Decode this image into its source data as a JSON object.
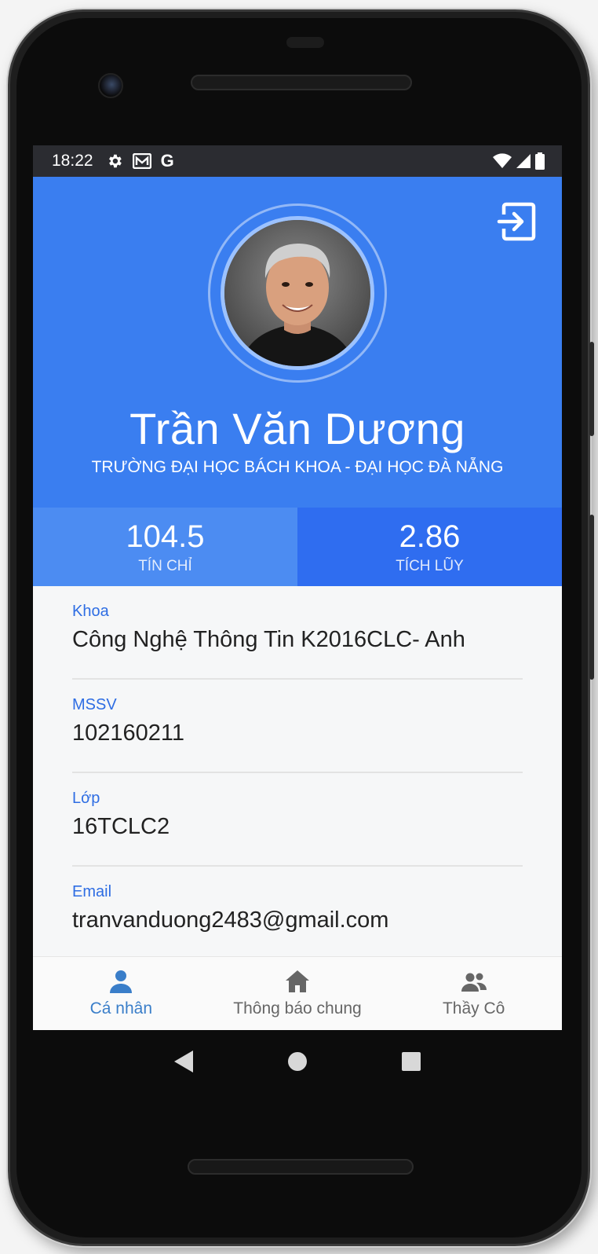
{
  "status_bar": {
    "time": "18:22",
    "left_icons": [
      "gear-icon",
      "mail-icon",
      "google-icon"
    ],
    "google_letter": "G",
    "right_icons": [
      "wifi-icon",
      "signal-icon",
      "battery-icon"
    ]
  },
  "header": {
    "name": "Trần Văn Dương",
    "school": "TRƯỜNG ĐẠI HỌC BÁCH KHOA - ĐẠI HỌC ĐÀ NẴNG",
    "logout_icon": "logout-icon",
    "bg_color": "#3a7ef0"
  },
  "stats": [
    {
      "value": "104.5",
      "label": "TÍN CHỈ"
    },
    {
      "value": "2.86",
      "label": "TÍCH LŨY"
    }
  ],
  "info": [
    {
      "label": "Khoa",
      "value": "Công Nghệ Thông Tin K2016CLC- Anh"
    },
    {
      "label": "MSSV",
      "value": "102160211"
    },
    {
      "label": "Lớp",
      "value": "16TCLC2"
    },
    {
      "label": "Email",
      "value": "tranvanduong2483@gmail.com"
    }
  ],
  "bottom_nav": [
    {
      "label": "Cá nhân",
      "icon": "person-icon",
      "active": true
    },
    {
      "label": "Thông báo chung",
      "icon": "home-icon",
      "active": false
    },
    {
      "label": "Thầy Cô",
      "icon": "people-icon",
      "active": false
    }
  ],
  "colors": {
    "primary": "#3a7ef0",
    "stat_left": "#4c8cf2",
    "stat_right": "#2f6df0",
    "label_blue": "#2e6de3",
    "nav_active": "#3a7ec9"
  }
}
